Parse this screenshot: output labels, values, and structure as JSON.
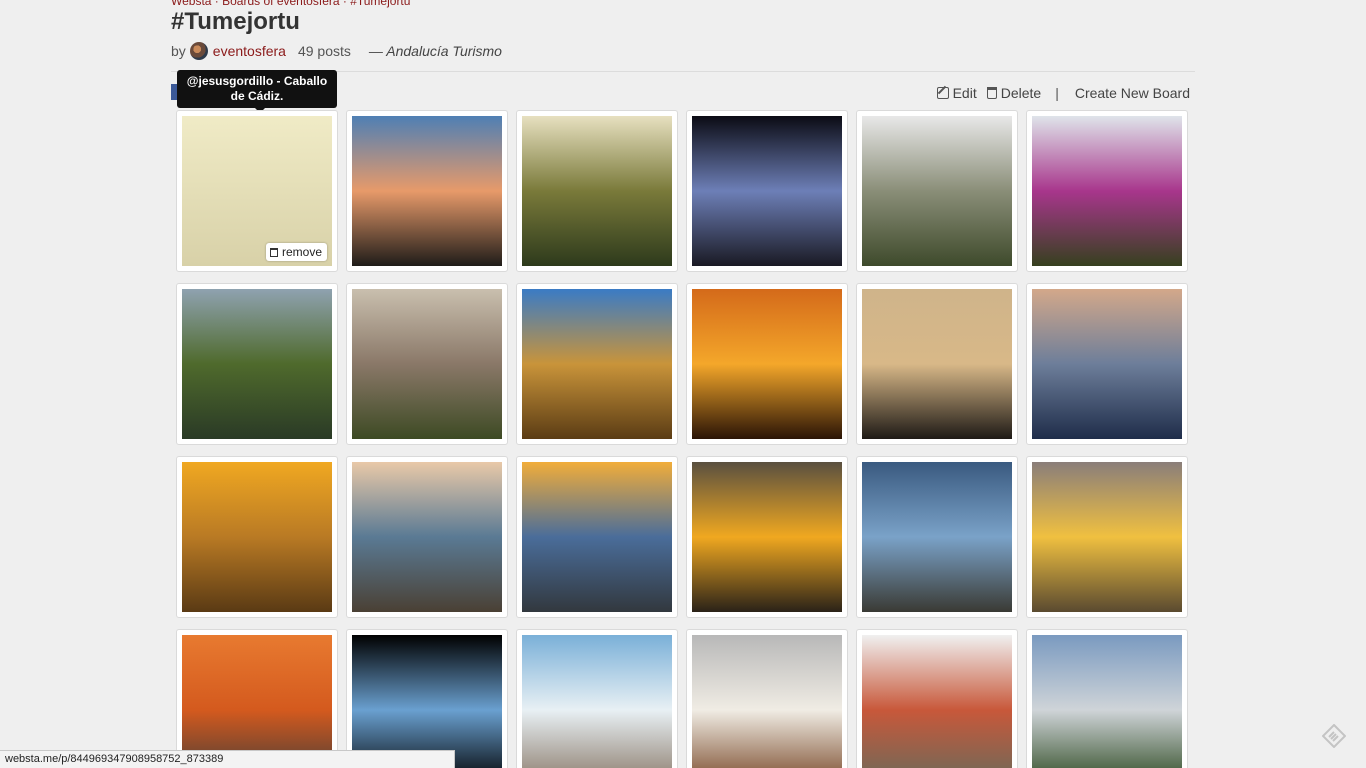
{
  "breadcrumb": "Websta · Boards of eventosfera · #Tumejortu",
  "board": {
    "title": "#Tumejortu",
    "by_label": "by",
    "author": "eventosfera",
    "posts": "49 posts",
    "source": "— Andalucía Turismo"
  },
  "tooltip": "@jesusgordillo - Caballo de Cádiz.",
  "actions": {
    "edit": "Edit",
    "delete": "Delete",
    "separator": "|",
    "create": "Create New Board"
  },
  "remove_label": "remove",
  "status_url": "websta.me/p/844969347908958752_873389",
  "colors": {
    "link": "#8b1a1a",
    "facebook": "#3b5998",
    "background": "#efefef"
  },
  "photos": [
    {
      "name": "photo-tabernero-bottle",
      "g": [
        "#f0ebc6",
        "#d8d1a8"
      ]
    },
    {
      "name": "photo-sunset-sea-clouds",
      "g": [
        "#4f7fb4",
        "#e79a6a",
        "#1f1c19"
      ]
    },
    {
      "name": "photo-forest-sun-village",
      "g": [
        "#e7e0c0",
        "#7a7a3a",
        "#2d3a1c"
      ]
    },
    {
      "name": "photo-lit-church-night",
      "g": [
        "#0b0b14",
        "#6d7fb7",
        "#1a1a24"
      ]
    },
    {
      "name": "photo-white-village-mountain",
      "g": [
        "#e8e8e8",
        "#8a8e78",
        "#3e4a2b"
      ]
    },
    {
      "name": "photo-bougainvillea-street",
      "g": [
        "#dfe4ea",
        "#a8368c",
        "#36401f"
      ]
    },
    {
      "name": "photo-garden-pond",
      "g": [
        "#8fa2b0",
        "#4f6a2c",
        "#2a3a26"
      ]
    },
    {
      "name": "photo-moorish-arch",
      "g": [
        "#c9bfae",
        "#8a7868",
        "#3d4a24"
      ]
    },
    {
      "name": "photo-cathedral-facade",
      "g": [
        "#3a7bc5",
        "#c9943a",
        "#5b3c14"
      ]
    },
    {
      "name": "photo-sunset-beach-orange",
      "g": [
        "#d46a1a",
        "#f4a72a",
        "#2a1406"
      ]
    },
    {
      "name": "photo-sunset-hazy-beach",
      "g": [
        "#cfb48a",
        "#d8b888",
        "#1e1a16"
      ]
    },
    {
      "name": "photo-sea-waves-dusk",
      "g": [
        "#d3a88a",
        "#6d7e9a",
        "#1f2d4a"
      ]
    },
    {
      "name": "photo-sand-footprints-sunset",
      "g": [
        "#f0a822",
        "#b97a24",
        "#5a3a14"
      ]
    },
    {
      "name": "photo-beach-rock-water",
      "g": [
        "#e9c9a8",
        "#5a7a94",
        "#4a4034"
      ]
    },
    {
      "name": "photo-barbed-wire-sunset",
      "g": [
        "#f1ad3a",
        "#4a6d9a",
        "#32383e"
      ]
    },
    {
      "name": "photo-cloudy-sunset-sea",
      "g": [
        "#5a5040",
        "#f0a820",
        "#2a2218"
      ]
    },
    {
      "name": "photo-kite-blue-sea",
      "g": [
        "#3a5a80",
        "#7aa2c8",
        "#3a3a34"
      ]
    },
    {
      "name": "photo-sunset-beach-rock",
      "g": [
        "#8a7e7a",
        "#f0c040",
        "#5a4a30"
      ]
    },
    {
      "name": "photo-orange-sunset-sea",
      "g": [
        "#e87a30",
        "#d45a1e",
        "#3a3a3a"
      ]
    },
    {
      "name": "photo-puzzle-cypress-mountain",
      "g": [
        "#000000",
        "#6aa0d0",
        "#000000"
      ]
    },
    {
      "name": "photo-white-arches-alley",
      "g": [
        "#7ab0d8",
        "#e8f0f4",
        "#8a7a6a"
      ]
    },
    {
      "name": "photo-white-church-rooftops",
      "g": [
        "#b8b8b8",
        "#f0ece4",
        "#7a4a2a"
      ]
    },
    {
      "name": "photo-flower-pots-street",
      "g": [
        "#f0f0f0",
        "#c8583a",
        "#6a6a5a"
      ]
    },
    {
      "name": "photo-hanging-bucket",
      "g": [
        "#7a9ac0",
        "#cfd4d8",
        "#2e4a22"
      ]
    }
  ]
}
